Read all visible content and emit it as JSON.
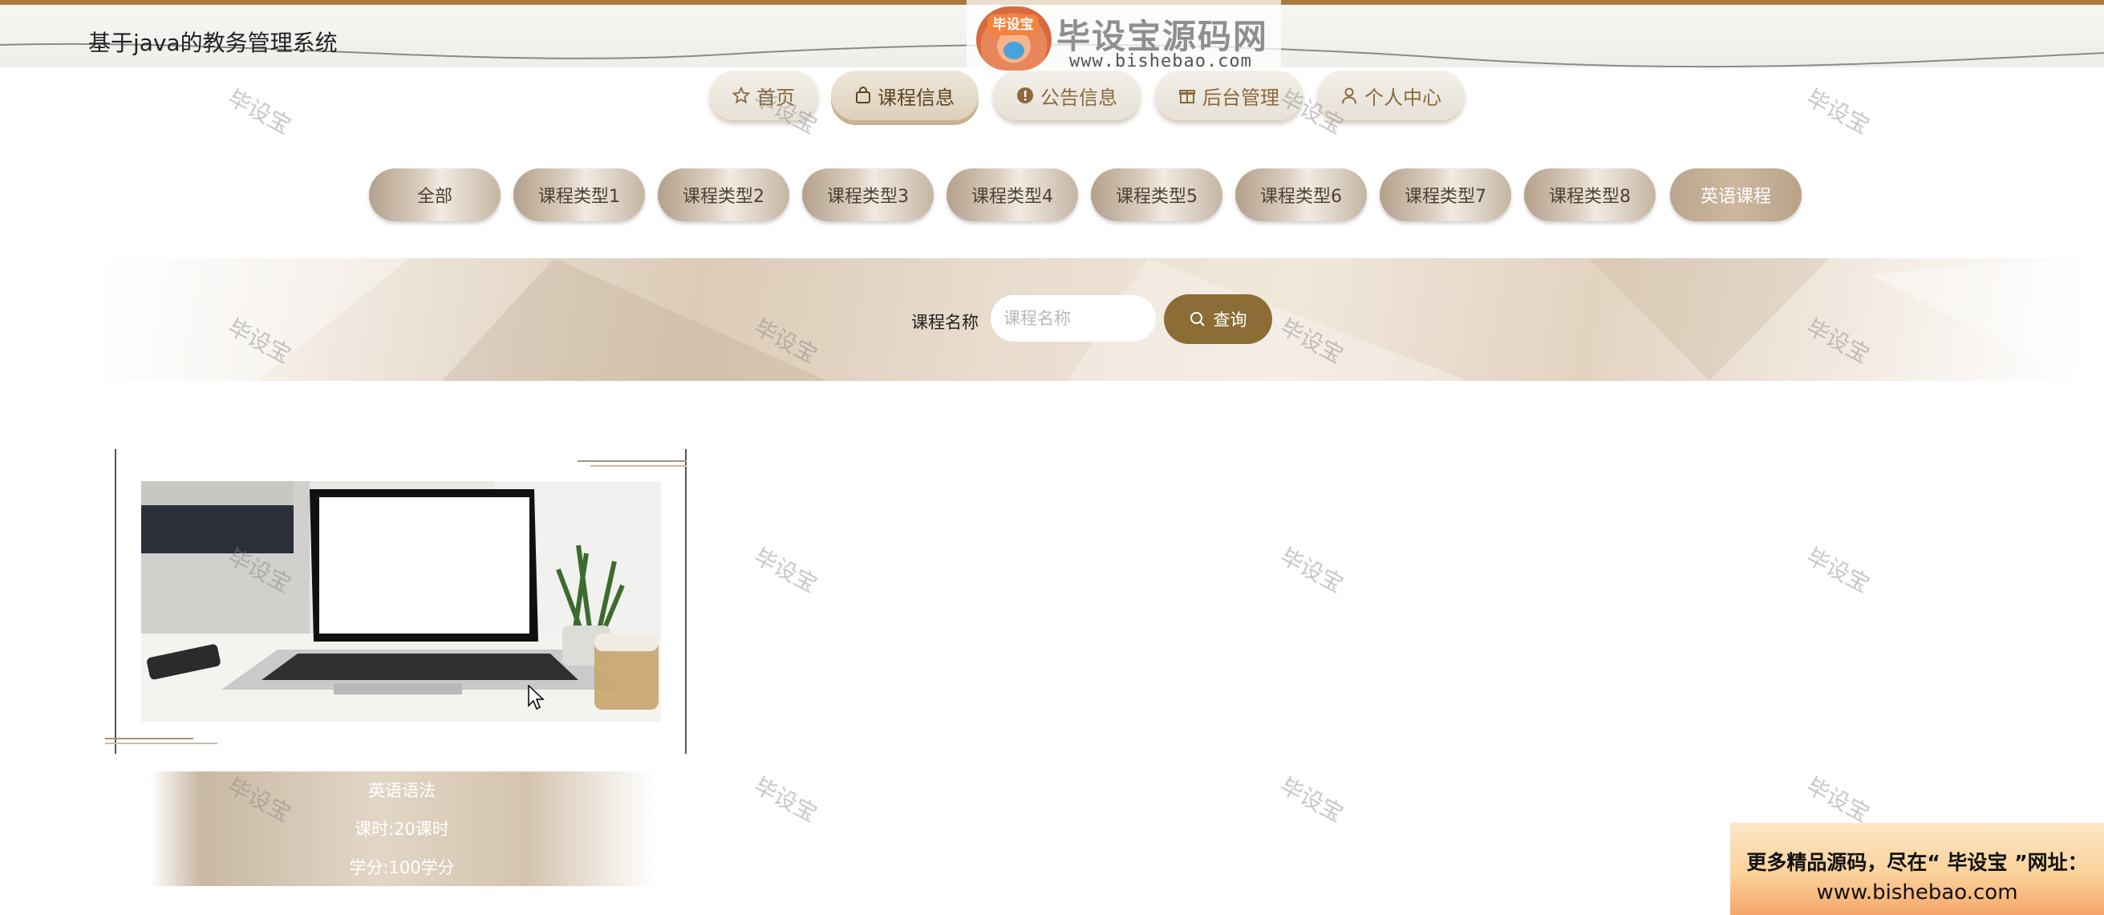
{
  "site": {
    "title": "基于java的教务管理系统"
  },
  "logo": {
    "name": "毕设宝源码网",
    "badge": "毕设宝",
    "url": "www.bishebao.com"
  },
  "nav": [
    {
      "label": "首页",
      "icon": "star-icon"
    },
    {
      "label": "课程信息",
      "icon": "bag-icon",
      "active": true
    },
    {
      "label": "公告信息",
      "icon": "alert-icon"
    },
    {
      "label": "后台管理",
      "icon": "gift-icon"
    },
    {
      "label": "个人中心",
      "icon": "user-icon"
    }
  ],
  "categories": [
    {
      "label": "全部"
    },
    {
      "label": "课程类型1"
    },
    {
      "label": "课程类型2"
    },
    {
      "label": "课程类型3"
    },
    {
      "label": "课程类型4"
    },
    {
      "label": "课程类型5"
    },
    {
      "label": "课程类型6"
    },
    {
      "label": "课程类型7"
    },
    {
      "label": "课程类型8"
    },
    {
      "label": "英语课程",
      "selected": true
    }
  ],
  "search": {
    "label": "课程名称",
    "placeholder": "课程名称",
    "value": "",
    "button": "查询",
    "button_icon": "search-icon"
  },
  "courses": [
    {
      "name": "英语语法",
      "hours": "课时:20课时",
      "credits": "学分:100学分"
    }
  ],
  "promo": {
    "line1": "更多精品源码，尽在“ 毕设宝 ”网址：",
    "line2": "www.bishebao.com"
  },
  "watermark": "毕设宝",
  "colors": {
    "accent": "#8c6d36",
    "topbar": "#a97b3f",
    "nav_text": "#8a6a3c"
  }
}
